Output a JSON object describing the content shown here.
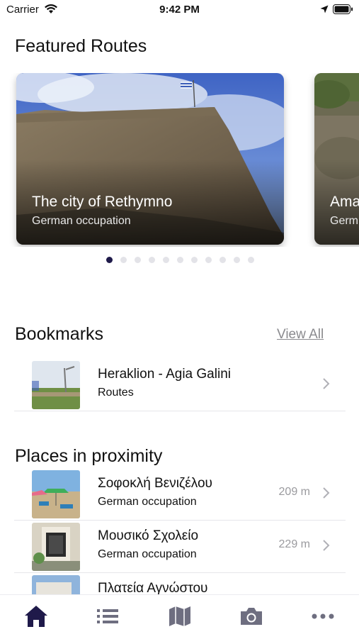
{
  "status_bar": {
    "carrier": "Carrier",
    "time": "9:42 PM"
  },
  "featured": {
    "heading": "Featured Routes",
    "cards": [
      {
        "title": "The city of Rethymno",
        "subtitle": "German occupation"
      },
      {
        "title": "Ama",
        "subtitle": "Germ"
      }
    ],
    "page_count": 11,
    "active_page": 0
  },
  "bookmarks": {
    "heading": "Bookmarks",
    "view_all": "View All",
    "items": [
      {
        "name": "Heraklion - Agia Galini",
        "category": "Routes"
      }
    ]
  },
  "proximity": {
    "heading": "Places in proximity",
    "items": [
      {
        "name": "Σοφοκλή Βενιζέλου",
        "category": "German occupation",
        "distance": "209 m"
      },
      {
        "name": "Μουσικό Σχολείο",
        "category": "German occupation",
        "distance": "229 m"
      },
      {
        "name": "Πλατεία Αγνώστου",
        "category": "",
        "distance": ""
      }
    ]
  },
  "tabbar": {
    "items": [
      "home-icon",
      "list-icon",
      "map-icon",
      "camera-icon",
      "more-icon"
    ],
    "active_index": 0,
    "active_color": "#1f1a4a",
    "inactive_color": "#6e6e80"
  }
}
